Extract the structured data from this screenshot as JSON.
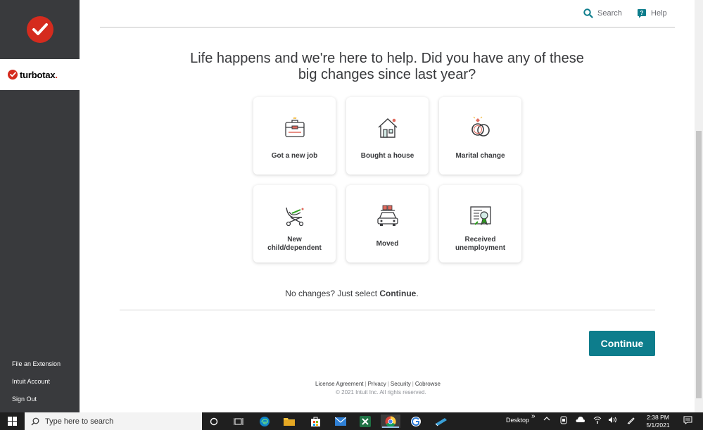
{
  "sidebar": {
    "brand": "turbotax",
    "links": [
      "File an Extension",
      "Intuit Account",
      "Sign Out"
    ]
  },
  "header": {
    "search_label": "Search",
    "help_label": "Help"
  },
  "main": {
    "headline_line1": "Life happens and we're here to help. Did you have any of these",
    "headline_line2": "big changes since last year?",
    "cards": [
      {
        "label": "Got a new job",
        "icon": "briefcase-icon"
      },
      {
        "label": "Bought a house",
        "icon": "house-icon"
      },
      {
        "label": "Marital change",
        "icon": "rings-icon"
      },
      {
        "label_line1": "New",
        "label_line2": "child/dependent",
        "icon": "stroller-icon"
      },
      {
        "label": "Moved",
        "icon": "moving-car-icon"
      },
      {
        "label_line1": "Received",
        "label_line2": "unemployment",
        "icon": "unemployment-document-icon"
      }
    ],
    "no_changes_text": "No changes? Just select ",
    "no_changes_bold": "Continue",
    "no_changes_end": ".",
    "continue_label": "Continue"
  },
  "footer": {
    "links": [
      "License Agreement",
      "Privacy",
      "Security",
      "Cobrowse"
    ],
    "copyright": "© 2021 Intuit Inc. All rights reserved."
  },
  "taskbar": {
    "search_placeholder": "Type here to search",
    "desktop_label": "Desktop",
    "time": "2:38 PM",
    "date": "5/1/2021"
  },
  "colors": {
    "sidebar": "#393a3d",
    "brand_red": "#d52b1e",
    "continue_button": "#0d7d8c",
    "text": "#393a3d"
  }
}
